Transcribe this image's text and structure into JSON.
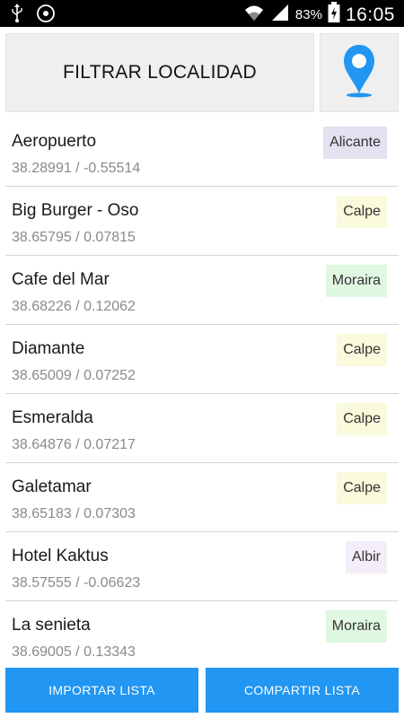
{
  "status_bar": {
    "battery_percent": "83%",
    "time": "16:05",
    "icons": [
      "usb-icon",
      "sync-icon",
      "wifi-icon",
      "signal-icon",
      "battery-charging-icon"
    ]
  },
  "header": {
    "filter_label": "FILTRAR LOCALIDAD",
    "location_icon": "map-pin-icon",
    "accent_color": "#2196f3"
  },
  "locations": [
    {
      "name": "Aeropuerto",
      "coords": "38.28991 / -0.55514",
      "town": "Alicante"
    },
    {
      "name": "Big Burger - Oso",
      "coords": "38.65795 / 0.07815",
      "town": "Calpe"
    },
    {
      "name": "Cafe del Mar",
      "coords": "38.68226 / 0.12062",
      "town": "Moraira"
    },
    {
      "name": "Diamante",
      "coords": "38.65009 / 0.07252",
      "town": "Calpe"
    },
    {
      "name": "Esmeralda",
      "coords": "38.64876 / 0.07217",
      "town": "Calpe"
    },
    {
      "name": "Galetamar",
      "coords": "38.65183 / 0.07303",
      "town": "Calpe"
    },
    {
      "name": "Hotel Kaktus",
      "coords": "38.57555 / -0.06623",
      "town": "Albir"
    },
    {
      "name": "La senieta",
      "coords": "38.69005 / 0.13343",
      "town": "Moraira"
    }
  ],
  "town_colors": {
    "Alicante": "#e2e2f0",
    "Calpe": "#fafadc",
    "Moraira": "#e0f7e2",
    "Albir": "#f4eef8"
  },
  "footer": {
    "import_label": "IMPORTAR LISTA",
    "share_label": "COMPARTIR LISTA"
  }
}
